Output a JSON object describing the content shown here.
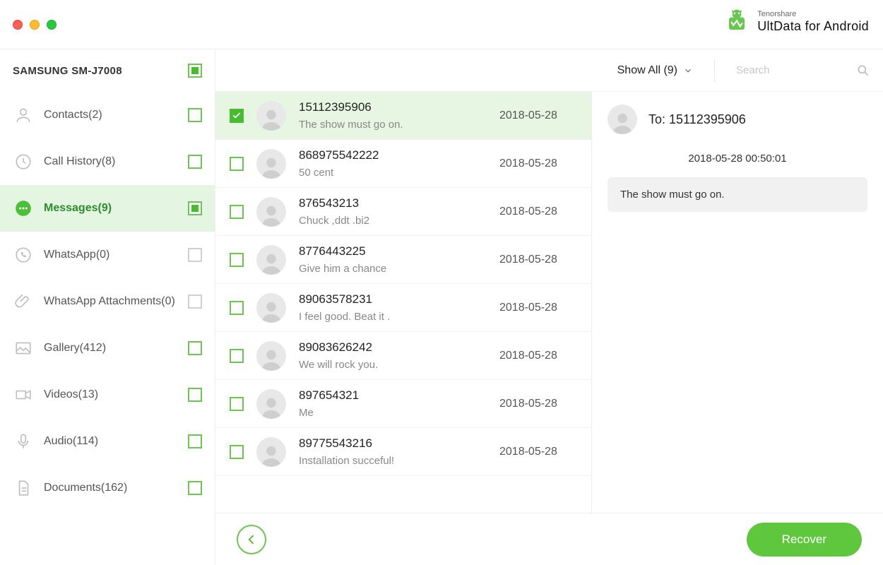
{
  "brand": {
    "small": "Tenorshare",
    "big": "UltData for Android"
  },
  "device_name": "SAMSUNG SM-J7008",
  "sidebar": {
    "items": [
      {
        "id": "contacts",
        "label": "Contacts(2)",
        "count": 2,
        "icon": "contacts-icon",
        "state": "empty"
      },
      {
        "id": "callhist",
        "label": "Call History(8)",
        "count": 8,
        "icon": "clock-icon",
        "state": "empty"
      },
      {
        "id": "messages",
        "label": "Messages(9)",
        "count": 9,
        "icon": "messages-icon",
        "state": "filled",
        "active": true
      },
      {
        "id": "whatsapp",
        "label": "WhatsApp(0)",
        "count": 0,
        "icon": "whatsapp-icon",
        "state": "gray"
      },
      {
        "id": "waattach",
        "label": "WhatsApp Attachments(0)",
        "count": 0,
        "icon": "paperclip-icon",
        "state": "gray"
      },
      {
        "id": "gallery",
        "label": "Gallery(412)",
        "count": 412,
        "icon": "image-icon",
        "state": "empty"
      },
      {
        "id": "videos",
        "label": "Videos(13)",
        "count": 13,
        "icon": "video-icon",
        "state": "empty"
      },
      {
        "id": "audio",
        "label": "Audio(114)",
        "count": 114,
        "icon": "mic-icon",
        "state": "empty"
      },
      {
        "id": "documents",
        "label": "Documents(162)",
        "count": 162,
        "icon": "doc-icon",
        "state": "empty"
      }
    ]
  },
  "filter_label": "Show All (9)",
  "search_placeholder": "Search",
  "messages": [
    {
      "number": "15112395906",
      "preview": "The show must go on.",
      "date": "2018-05-28",
      "checked": true,
      "selected": true
    },
    {
      "number": "868975542222",
      "preview": "50 cent",
      "date": "2018-05-28",
      "checked": false,
      "selected": false
    },
    {
      "number": "876543213",
      "preview": "Chuck ,ddt .bi2",
      "date": "2018-05-28",
      "checked": false,
      "selected": false
    },
    {
      "number": "8776443225",
      "preview": "Give him a chance",
      "date": "2018-05-28",
      "checked": false,
      "selected": false
    },
    {
      "number": "89063578231",
      "preview": "I feel good. Beat it .",
      "date": "2018-05-28",
      "checked": false,
      "selected": false
    },
    {
      "number": "89083626242",
      "preview": "We will rock you.",
      "date": "2018-05-28",
      "checked": false,
      "selected": false
    },
    {
      "number": "897654321",
      "preview": "Me",
      "date": "2018-05-28",
      "checked": false,
      "selected": false
    },
    {
      "number": "89775543216",
      "preview": "Installation  succeful!",
      "date": "2018-05-28",
      "checked": false,
      "selected": false
    }
  ],
  "detail": {
    "to_label": "To: 15112395906",
    "date": "2018-05-28 00:50:01",
    "body": "The show must go on."
  },
  "recover_label": "Recover"
}
